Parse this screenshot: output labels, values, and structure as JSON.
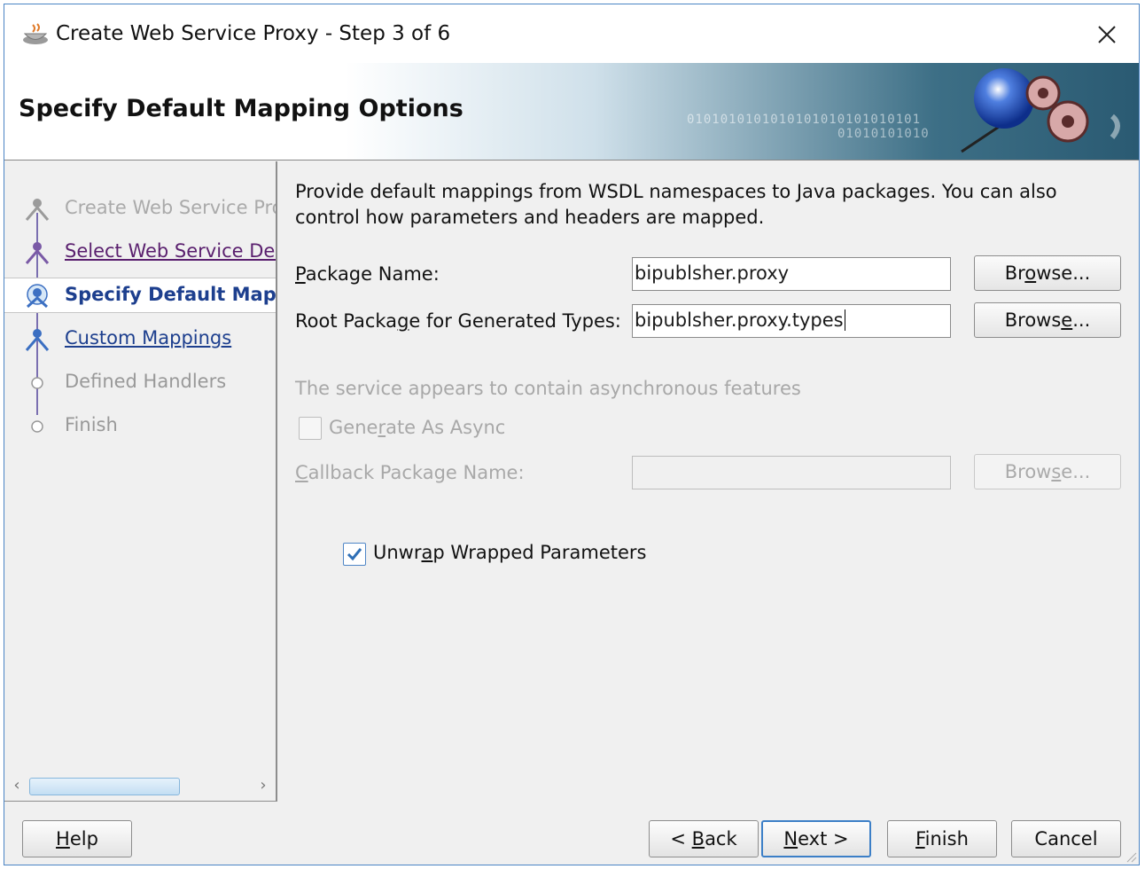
{
  "window": {
    "title": "Create Web Service Proxy - Step 3 of 6",
    "close_glyph": "✕"
  },
  "banner": {
    "title": "Specify Default Mapping Options",
    "binary_1": "0101010101010101010101010101",
    "binary_2": "01010101010"
  },
  "steps": [
    {
      "label": "Create Web Service Proxy",
      "state": "done"
    },
    {
      "label": "Select Web Service Description",
      "state": "visited"
    },
    {
      "label": "Specify Default Mapping Options",
      "state": "current"
    },
    {
      "label": "Custom Mappings",
      "state": "next"
    },
    {
      "label": "Defined Handlers",
      "state": "future"
    },
    {
      "label": "Finish",
      "state": "future"
    }
  ],
  "content": {
    "description": "Provide default mappings from WSDL namespaces to Java packages. You can also control how parameters and headers are mapped.",
    "package_name": {
      "label_pre": "",
      "label_mn": "P",
      "label_post": "ackage Name:",
      "value": "bipublsher.proxy"
    },
    "root_package": {
      "label_pre": "Root Packa",
      "label_mn": "g",
      "label_post": "e for Generated Types:",
      "value": "bipublsher.proxy.types"
    },
    "async_notice": "The service appears to contain asynchronous features",
    "generate_async": {
      "label_pre": "Gene",
      "label_mn": "r",
      "label_post": "ate As Async",
      "checked": false
    },
    "callback_package": {
      "label_pre": "",
      "label_mn": "C",
      "label_post": "allback Package Name:",
      "value": ""
    },
    "unwrap": {
      "label_pre": "Unwr",
      "label_mn": "a",
      "label_post": "p Wrapped Parameters",
      "checked": true
    },
    "browse1": {
      "pre": "Br",
      "mn": "o",
      "post": "wse..."
    },
    "browse2": {
      "pre": "Brows",
      "mn": "e",
      "post": "..."
    },
    "browse3": {
      "pre": "Brow",
      "mn": "s",
      "post": "e..."
    }
  },
  "buttons": {
    "help": {
      "pre": "",
      "mn": "H",
      "post": "elp"
    },
    "back": {
      "pre": "< ",
      "mn": "B",
      "post": "ack"
    },
    "next": {
      "pre": "",
      "mn": "N",
      "post": "ext >"
    },
    "finish": {
      "pre": "",
      "mn": "F",
      "post": "inish"
    },
    "cancel": {
      "pre": "",
      "mn": "",
      "post": "Cancel"
    }
  },
  "colors": {
    "accent": "#3c7fc7",
    "current_step": "#1d3f8e",
    "visited_step": "#5a1f6e",
    "disabled_text": "#a8a8a8"
  }
}
